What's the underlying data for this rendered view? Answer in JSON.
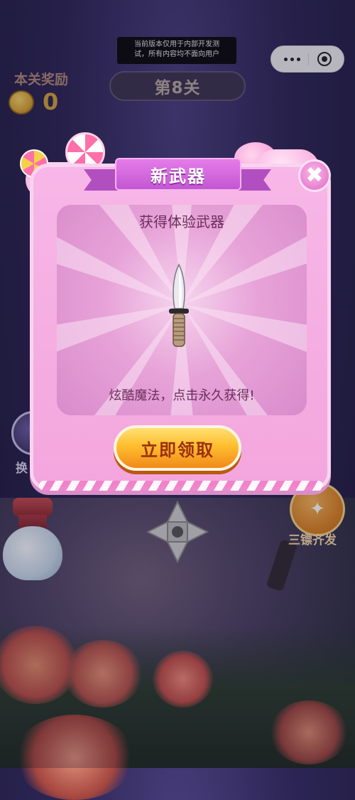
{
  "notice": {
    "line1": "当前版本仅用于内部开发测",
    "line2": "试，所有内容均不面向用户"
  },
  "capsule": {
    "more_icon": "more-dots-icon",
    "close_icon": "target-close-icon"
  },
  "level": {
    "label": "第8关"
  },
  "reward": {
    "title": "本关奖励",
    "coin_icon": "candy-coin-icon",
    "value": "0"
  },
  "dialog": {
    "title": "新武器",
    "subtitle": "获得体验武器",
    "weapon_icon": "knife-icon",
    "description": "炫酷魔法，点击永久获得!",
    "claim_label": "立即领取",
    "close_symbol": "✖"
  },
  "side": {
    "left_label": "换",
    "right_label": "三镖齐发",
    "right_icon": "magic-wand-stars-icon"
  },
  "colors": {
    "dialog_bg": "#f3a6dd",
    "ribbon": "#c257d2",
    "claim_button": "#ffbe2e",
    "claim_text": "#9b2f10",
    "inner_text": "#6b2e5a"
  }
}
